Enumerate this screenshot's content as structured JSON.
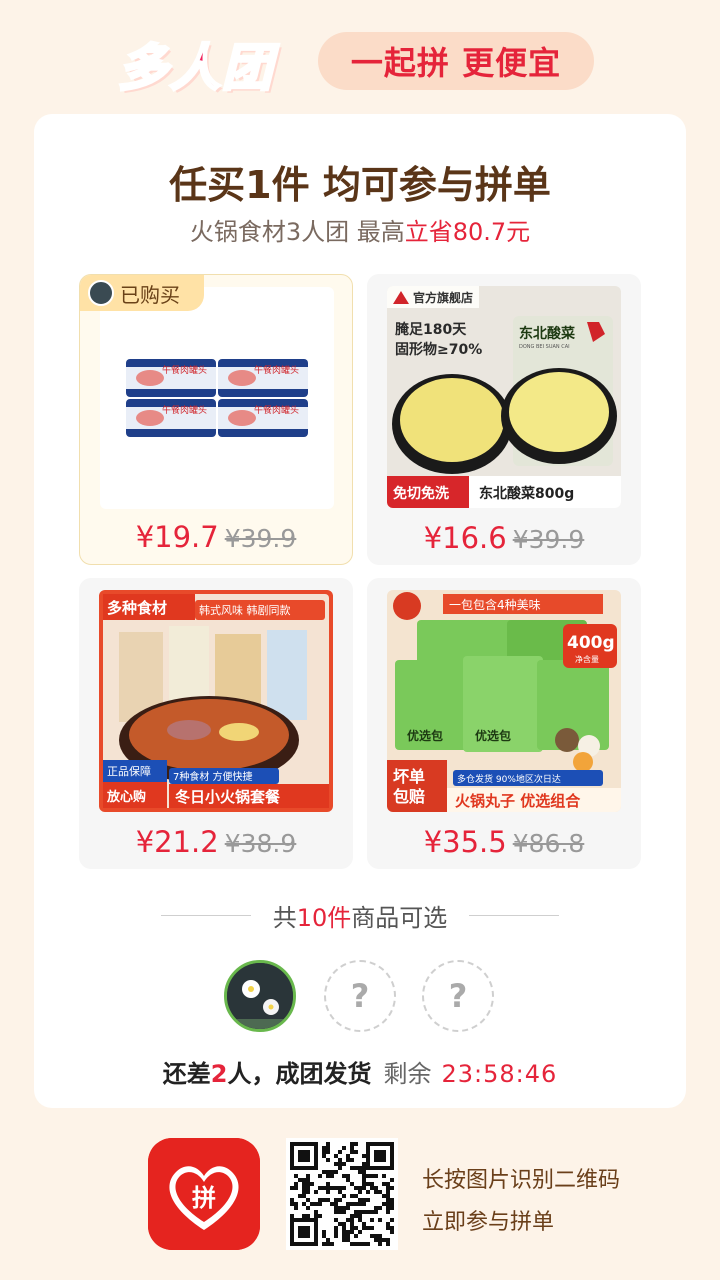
{
  "header": {
    "logo_text": "多人团",
    "slogan": "一起拼 更便宜"
  },
  "card": {
    "title": "任买1件 均可参与拼单",
    "subtitle_prefix": "火锅食材3人团 最高",
    "subtitle_highlight": "立省80.7元"
  },
  "products": [
    {
      "price": "¥19.7",
      "original_price": "¥39.9",
      "badge": "已购买",
      "image_labels": [
        "午餐肉罐头",
        "午餐肉罐头",
        "午餐肉罐头",
        "午餐肉罐头"
      ]
    },
    {
      "price": "¥16.6",
      "original_price": "¥39.9",
      "image_labels": [
        "官方旗舰店",
        "腌足180天",
        "固形物≥70%",
        "东北酸菜",
        "DONG BEI SUAN CAI",
        "免切免洗",
        "东北酸菜800g"
      ]
    },
    {
      "price": "¥21.2",
      "original_price": "¥38.9",
      "image_labels": [
        "多种食材",
        "韩式风味 韩剧同款",
        "正品保障",
        "放心购",
        "7种食材 方便快捷",
        "冬日小火锅套餐"
      ]
    },
    {
      "price": "¥35.5",
      "original_price": "¥86.8",
      "image_labels": [
        "一包包含4种美味",
        "400g",
        "净含量",
        "优选包",
        "优选包",
        "坏单",
        "包赔",
        "多仓发货 90%地区次日达",
        "火锅丸子 优选组合"
      ]
    }
  ],
  "divider": {
    "prefix": "共",
    "count": "10件",
    "suffix": "商品可选"
  },
  "group": {
    "empty_slot_mark": "?",
    "status_prefix": "还差",
    "status_count": "2",
    "status_suffix": "人，成团发货",
    "remaining_label": "剩余",
    "timer": "23:58:46"
  },
  "footer": {
    "app_icon_text": "拼",
    "line1": "长按图片识别二维码",
    "line2": "立即参与拼单"
  },
  "colors": {
    "accent": "#e5243a",
    "brown": "#5a3518",
    "page_bg": "#fdf3e8"
  }
}
